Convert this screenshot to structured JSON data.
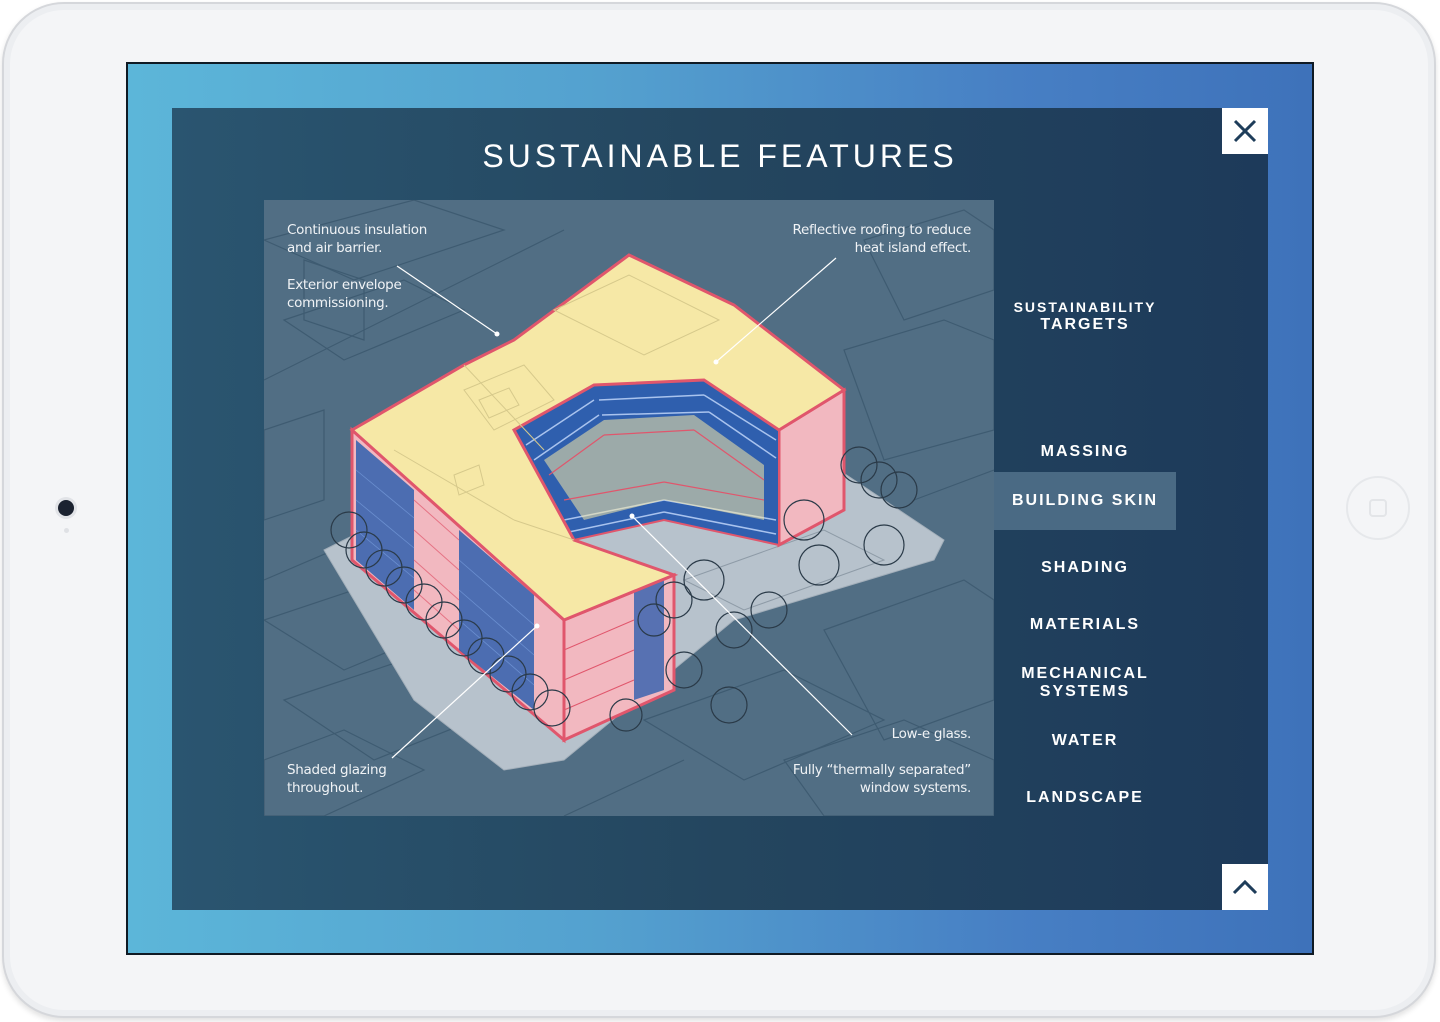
{
  "modal": {
    "title": "SUSTAINABLE FEATURES",
    "close_icon": "close-icon",
    "up_icon": "chevron-up-icon"
  },
  "annotations": {
    "insulation": [
      "Continuous insulation",
      "and air barrier."
    ],
    "envelope": [
      "Exterior envelope",
      "commissioning."
    ],
    "roofing": [
      "Reflective roofing to reduce",
      "heat island effect."
    ],
    "glazing": [
      "Shaded glazing",
      "throughout."
    ],
    "lowe": [
      "Low-e glass."
    ],
    "window": [
      "Fully “thermally separated”",
      "window systems."
    ]
  },
  "menu": {
    "items": [
      {
        "line1": "SUSTAINABILITY",
        "line2": "TARGETS"
      },
      {
        "line1": "MASSING",
        "line2": ""
      },
      {
        "line1": "BUILDING SKIN",
        "line2": "",
        "active": true
      },
      {
        "line1": "SHADING",
        "line2": ""
      },
      {
        "line1": "MATERIALS",
        "line2": ""
      },
      {
        "line1": "MECHANICAL",
        "line2": "SYSTEMS"
      },
      {
        "line1": "WATER",
        "line2": ""
      },
      {
        "line1": "LANDSCAPE",
        "line2": ""
      }
    ]
  },
  "colors": {
    "roof": "#f6e8a6",
    "facade": "#f2b8c0",
    "outline": "#e0566c",
    "glass": "#2f5fae",
    "ground": "#b7c2cc",
    "figure_bg": "#516e84",
    "active_item": "#4a6a84"
  }
}
